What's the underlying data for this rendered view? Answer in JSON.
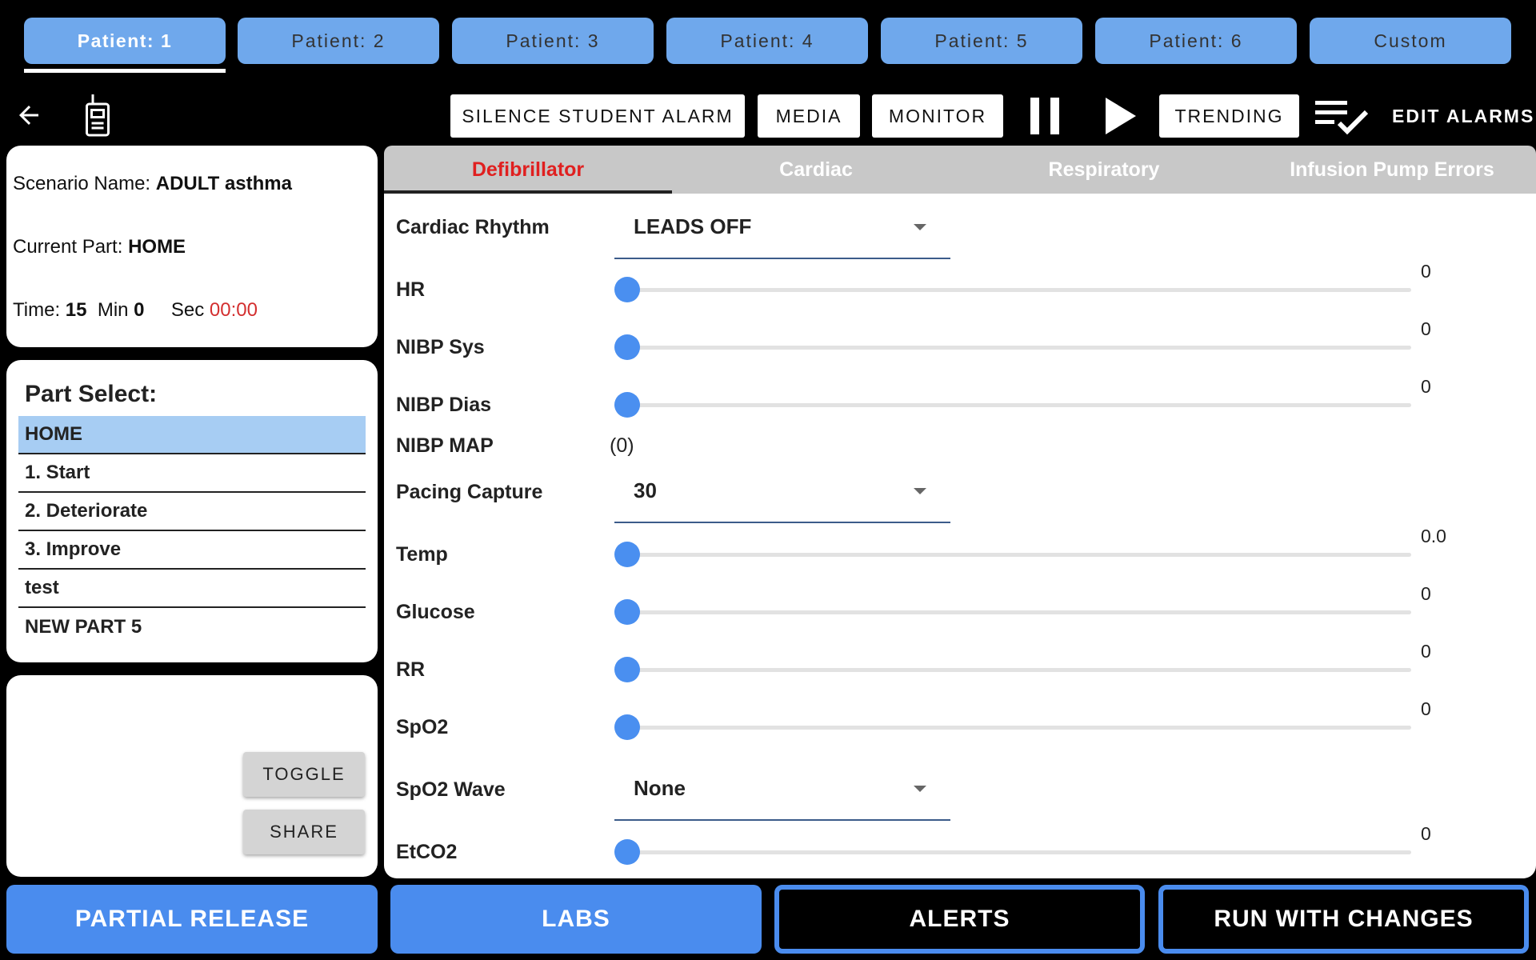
{
  "patient_tabs": [
    {
      "label": "Patient: 1",
      "active": true
    },
    {
      "label": "Patient: 2",
      "active": false
    },
    {
      "label": "Patient: 3",
      "active": false
    },
    {
      "label": "Patient: 4",
      "active": false
    },
    {
      "label": "Patient: 5",
      "active": false
    },
    {
      "label": "Patient: 6",
      "active": false
    },
    {
      "label": "Custom",
      "active": false
    }
  ],
  "toolbar": {
    "silence_label": "SILENCE STUDENT ALARM",
    "media_label": "MEDIA",
    "monitor_label": "MONITOR",
    "trending_label": "TRENDING",
    "edit_alarms_label": "EDIT ALARMS",
    "icons": [
      "arrow-left-icon",
      "radio-icon",
      "pause-icon",
      "play-icon",
      "checklist-icon"
    ]
  },
  "scenario": {
    "name_label": "Scenario Name:",
    "name_value": "ADULT asthma",
    "part_label": "Current Part:",
    "part_value": "HOME",
    "time_label": "Time:",
    "time_min_value": "15",
    "min_label": "Min",
    "min_sec_value": "0",
    "sec_label": "Sec",
    "clock": "00:00"
  },
  "part_select": {
    "title": "Part Select:",
    "items": [
      "HOME",
      "1. Start",
      "2. Deteriorate",
      "3. Improve",
      "test",
      "NEW PART 5"
    ],
    "selected": "HOME"
  },
  "tools": {
    "toggle_label": "TOGGLE",
    "share_label": "SHARE"
  },
  "main_tabs": [
    {
      "label": "Defibrillator",
      "active": true
    },
    {
      "label": "Cardiac",
      "active": false
    },
    {
      "label": "Respiratory",
      "active": false
    },
    {
      "label": "Infusion Pump Errors",
      "active": false
    }
  ],
  "controls": {
    "cardiac_rhythm": {
      "label": "Cardiac Rhythm",
      "value": "LEADS OFF"
    },
    "hr": {
      "label": "HR",
      "value": "0"
    },
    "nibp_sys": {
      "label": "NIBP Sys",
      "value": "0"
    },
    "nibp_dias": {
      "label": "NIBP Dias",
      "value": "0"
    },
    "nibp_map": {
      "label": "NIBP MAP",
      "value": "(0)"
    },
    "pacing_capture": {
      "label": "Pacing Capture",
      "value": "30"
    },
    "temp": {
      "label": "Temp",
      "value": "0.0"
    },
    "glucose": {
      "label": "Glucose",
      "value": "0"
    },
    "rr": {
      "label": "RR",
      "value": "0"
    },
    "spo2": {
      "label": "SpO2",
      "value": "0"
    },
    "spo2_wave": {
      "label": "SpO2 Wave",
      "value": "None"
    },
    "etco2": {
      "label": "EtCO2",
      "value": "0"
    }
  },
  "colors": {
    "tab_blue": "#6fa8ec",
    "accent_blue": "#4a8cee",
    "active_tab_red": "#e02020",
    "selected_part": "#a7cdf3",
    "clock_red": "#d32f2f"
  },
  "bottom_bar": {
    "partial_release_label": "PARTIAL RELEASE",
    "labs_label": "LABS",
    "alerts_label": "ALERTS",
    "run_label": "RUN WITH CHANGES"
  }
}
